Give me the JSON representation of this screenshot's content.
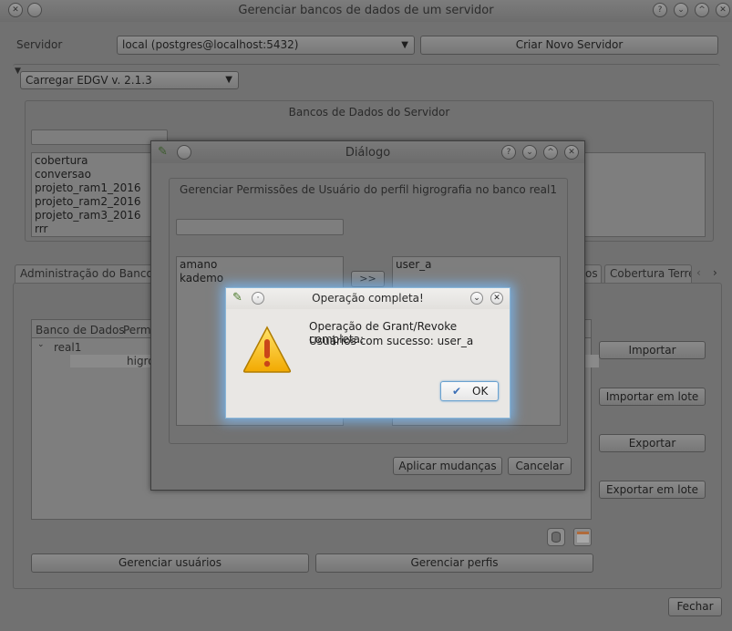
{
  "window": {
    "title": "Gerenciar bancos de dados de um servidor"
  },
  "server": {
    "label": "Servidor",
    "selected": "local (postgres@localhost:5432)",
    "new_server_button": "Criar Novo Servidor"
  },
  "edgv": {
    "selected": "Carregar EDGV v. 2.1.3"
  },
  "databases": {
    "title": "Bancos de Dados do Servidor",
    "items": [
      "cobertura",
      "conversao",
      "projeto_ram1_2016",
      "projeto_ram2_2016",
      "projeto_ram3_2016",
      "rrr"
    ]
  },
  "tabs": [
    "Administração do Banco de",
    "os",
    "Cobertura Terres"
  ],
  "tree": {
    "columns": [
      "Banco de Dados",
      "Perm"
    ],
    "root": "real1",
    "child": "higro"
  },
  "side_buttons": [
    "Importar",
    "Importar em lote",
    "Exportar",
    "Exportar em lote"
  ],
  "bottom_buttons": {
    "users": "Gerenciar usuários",
    "profiles": "Gerenciar perfis"
  },
  "close_button": "Fechar",
  "dialog": {
    "title": "Diálogo",
    "heading": "Gerenciar Permissões de Usuário do perfil higrografia no banco real1",
    "left_users": [
      "amano",
      "kademo"
    ],
    "right_users": [
      "user_a"
    ],
    "move_button": ">>",
    "apply_button": "Aplicar mudanças",
    "cancel_button": "Cancelar"
  },
  "message": {
    "title": "Operação completa!",
    "line1": "Operação de Grant/Revoke completa:",
    "line2": "Usuários com sucesso: user_a",
    "ok_button": "OK"
  },
  "colors": {
    "dim_background": "#717171",
    "message_bg": "#e9e7e4",
    "warning": "#f2c200",
    "glow": "#78beff"
  }
}
